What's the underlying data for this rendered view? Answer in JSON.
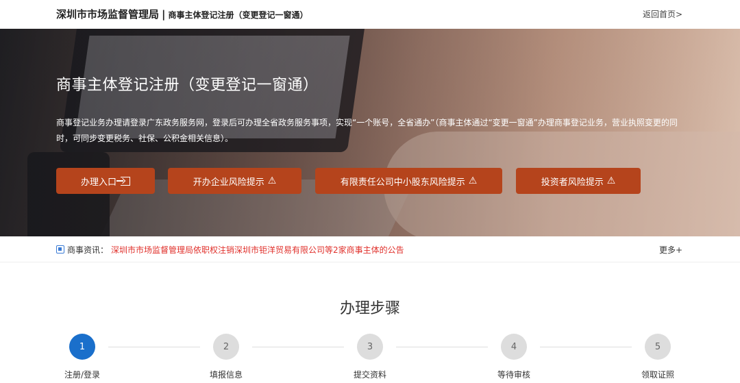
{
  "header": {
    "org": "深圳市市场监督管理局",
    "separator": "|",
    "subtitle": "商事主体登记注册（变更登记一窗通）",
    "home_link": "返回首页>"
  },
  "hero": {
    "title": "商事主体登记注册（变更登记一窗通）",
    "description": "商事登记业务办理请登录广东政务服务网，登录后可办理全省政务服务事项，实现“一个账号，全省通办”（商事主体通过“变更一窗通”办理商事登记业务，营业执照变更的同时，可同步变更税务、社保、公积金相关信息）。",
    "buttons": {
      "entry": "办理入口",
      "risk_enterprise": "开办企业风险提示",
      "risk_shareholder": "有限责任公司中小股东风险提示",
      "risk_investor": "投资者风险提示"
    },
    "button_color": "#b5441c"
  },
  "news": {
    "label": "商事资讯：",
    "headline": "深圳市市场监督管理局依职权注销深圳市钜洋贸易有限公司等2家商事主体的公告",
    "more": "更多+",
    "headline_color": "#e0302b"
  },
  "steps": {
    "title": "办理步骤",
    "items": [
      {
        "number": "1",
        "label": "注册/登录",
        "active": true
      },
      {
        "number": "2",
        "label": "填报信息",
        "active": false
      },
      {
        "number": "3",
        "label": "提交资料",
        "active": false
      },
      {
        "number": "4",
        "label": "等待审核",
        "active": false
      },
      {
        "number": "5",
        "label": "领取证照",
        "active": false
      }
    ],
    "active_color": "#1a6fcb"
  }
}
